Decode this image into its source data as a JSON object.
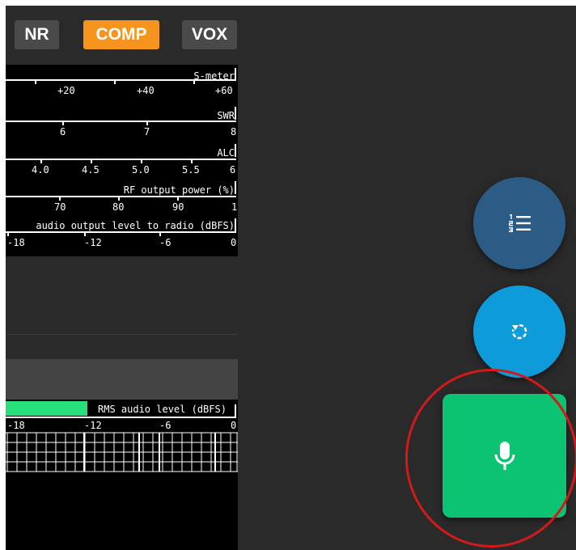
{
  "toggles": {
    "nr": "NR",
    "comp": "COMP",
    "vox": "VOX",
    "comp_active_color": "#f7941d",
    "inactive_color": "#4a4a4a"
  },
  "meters": [
    {
      "title": "S-meter",
      "ticks": [
        "+20",
        "+40",
        "+60"
      ]
    },
    {
      "title": "SWR",
      "ticks": [
        "6",
        "7",
        "8"
      ]
    },
    {
      "title": "ALC",
      "ticks": [
        "4.0",
        "4.5",
        "5.0",
        "5.5",
        "6"
      ]
    },
    {
      "title": "RF output power (%)",
      "ticks": [
        "70",
        "80",
        "90",
        "1"
      ]
    },
    {
      "title": "audio output level to radio (dBFS)",
      "ticks": [
        "-18",
        "-12",
        "-6",
        "0"
      ]
    }
  ],
  "rms": {
    "title": "RMS audio level (dBFS)",
    "ticks": [
      "-18",
      "-12",
      "-6",
      "0"
    ],
    "bar_color": "#27e07c"
  },
  "fabs": {
    "list_icon": "numbered-list-icon",
    "refresh_icon": "refresh-icon",
    "mic_icon": "microphone-icon",
    "list_color": "#2c5c86",
    "refresh_color": "#0d9bd9",
    "mic_color": "#0bc372",
    "highlight_color": "#d11a1a"
  }
}
